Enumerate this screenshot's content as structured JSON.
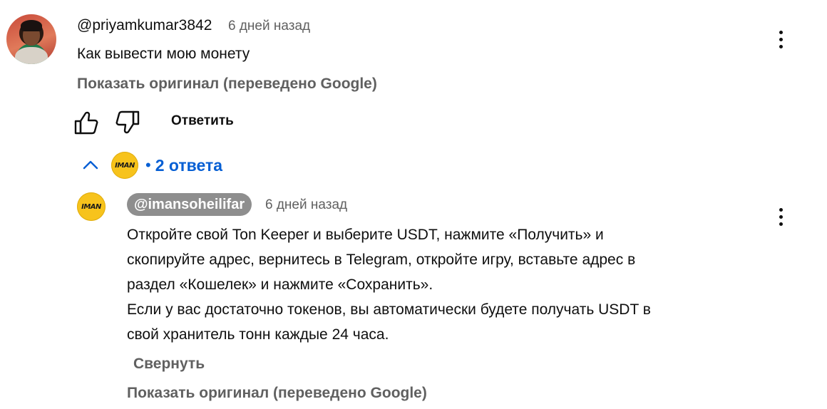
{
  "comment": {
    "author": "@priyamkumar3842",
    "time": "6 дней назад",
    "text": "Как вывести мою монету",
    "translation_link": "Показать оригинал (переведено Google)",
    "reply_label": "Ответить",
    "icons": [
      "thumbs-up-icon",
      "thumbs-down-icon",
      "more-vert-icon"
    ]
  },
  "replies": {
    "toggle_icon": "chevron-up-icon",
    "separator": "•",
    "count_label": "2 ответа",
    "avatar_text": "IMAN"
  },
  "reply": {
    "author": "@imansoheilifar",
    "time": "6 дней назад",
    "avatar_text": "IMAN",
    "lines": [
      "Откройте свой Ton Keeper и выберите USDT, нажмите «Получить» и",
      "скопируйте адрес, вернитесь в Telegram, откройте игру, вставьте адрес в",
      "раздел «Кошелек» и нажмите «Сохранить».",
      "Если у вас достаточно токенов, вы автоматически будете получать USDT в",
      "свой хранитель тонн каждые 24 часа."
    ],
    "collapse_label": "Свернуть",
    "translation_link": "Показать оригинал (переведено Google)"
  },
  "colors": {
    "link_blue": "#065fd4",
    "secondary_text": "#606060",
    "pill_bg": "#8e8e8e",
    "iman_yellow": "#f7c31c"
  }
}
